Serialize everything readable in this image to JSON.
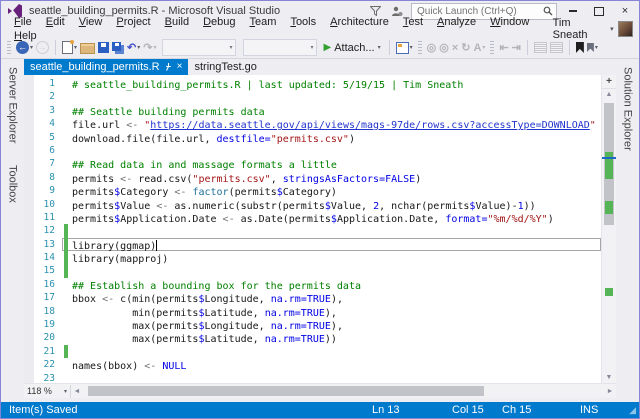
{
  "window": {
    "title": "seattle_building_permits.R - Microsoft Visual Studio",
    "quick_launch": "Quick Launch (Ctrl+Q)"
  },
  "icons": {
    "close_glyph": "×",
    "tab_close_glyph": "×",
    "split_glyph": "+",
    "up_glyph": "▲",
    "down_glyph": "▼",
    "left_glyph": "◄",
    "right_glyph": "►",
    "grip_glyph": "◢",
    "user_caret": "▾"
  },
  "menu": {
    "items": [
      "File",
      "Edit",
      "View",
      "Project",
      "Build",
      "Debug",
      "Team",
      "Tools",
      "Architecture",
      "Test",
      "Analyze",
      "Window",
      "Help"
    ],
    "user": "Tim Sneath"
  },
  "toolbar": {
    "attach_label": "Attach...",
    "items": [
      {
        "name": "toolbar-grip",
        "kind": "grip"
      },
      {
        "name": "navigate-back-button",
        "kind": "css",
        "cls": "i-back",
        "glyph": "←",
        "caret": true
      },
      {
        "name": "navigate-forward-button",
        "kind": "css",
        "cls": "i-fwd",
        "glyph": "→",
        "disabled": true
      },
      {
        "name": "toolbar-separator",
        "kind": "sep"
      },
      {
        "name": "new-file-button",
        "kind": "css",
        "cls": "i-new",
        "caret": true
      },
      {
        "name": "open-file-button",
        "kind": "css",
        "cls": "i-open"
      },
      {
        "name": "save-button",
        "kind": "css",
        "cls": "i-save"
      },
      {
        "name": "save-all-button",
        "kind": "css",
        "cls": "i-saveall"
      },
      {
        "name": "undo-button",
        "kind": "glyph",
        "glyph": "↶",
        "color": "#4650C8",
        "caret": true
      },
      {
        "name": "redo-button",
        "kind": "glyph",
        "glyph": "↷",
        "disabled": true,
        "caret": true
      },
      {
        "name": "debug-target-combobox",
        "kind": "combo"
      },
      {
        "name": "solution-configurations-combobox",
        "kind": "combo"
      },
      {
        "name": "attach-debugger-button",
        "kind": "attach",
        "caret": true
      },
      {
        "name": "toolbar-separator",
        "kind": "sep"
      },
      {
        "name": "breakpoints-window-button",
        "kind": "css",
        "cls": "i-bpwin",
        "caret": true
      },
      {
        "name": "toolbar-grip",
        "kind": "grip"
      },
      {
        "name": "break-all-button",
        "kind": "glyph",
        "glyph": "◎",
        "disabled": true
      },
      {
        "name": "stop-debugging-button",
        "kind": "glyph",
        "glyph": "◎",
        "disabled": true
      },
      {
        "name": "close-debugger-button",
        "kind": "glyph",
        "glyph": "×",
        "disabled": true
      },
      {
        "name": "restart-button",
        "kind": "glyph",
        "glyph": "↻",
        "disabled": true
      },
      {
        "name": "font-options-button",
        "kind": "glyph",
        "glyph": "A",
        "disabled": true,
        "caret": true
      },
      {
        "name": "toolbar-grip",
        "kind": "grip"
      },
      {
        "name": "indent-decrease-button",
        "kind": "glyph",
        "glyph": "⇤",
        "disabled": true
      },
      {
        "name": "indent-increase-button",
        "kind": "glyph",
        "glyph": "⇥",
        "disabled": true
      },
      {
        "name": "toolbar-separator",
        "kind": "sep"
      },
      {
        "name": "comment-button",
        "kind": "css",
        "cls": "i-comment",
        "disabled": true
      },
      {
        "name": "uncomment-button",
        "kind": "css",
        "cls": "i-comment",
        "disabled": true
      },
      {
        "name": "toolbar-separator",
        "kind": "sep"
      },
      {
        "name": "toggle-bookmark-button",
        "kind": "css",
        "cls": "i-bookmark"
      },
      {
        "name": "next-bookmark-button",
        "kind": "css",
        "cls": "i-bookmark-sm",
        "caret": true
      }
    ]
  },
  "tabs": [
    {
      "label": "seattle_building_permits.R",
      "active": true
    },
    {
      "label": "stringTest.go",
      "active": false
    }
  ],
  "side": {
    "left": [
      "Server Explorer",
      "Toolbox"
    ],
    "right": [
      "Solution Explorer"
    ]
  },
  "editor": {
    "zoom_level": "118 %",
    "lines": [
      {
        "n": 1,
        "segs": [
          [
            "com",
            "# seattle_building_permits.R | last updated: 5/19/15 | Tim Sneath"
          ]
        ]
      },
      {
        "n": 2,
        "segs": []
      },
      {
        "n": 3,
        "segs": [
          [
            "com",
            "## Seattle building permits data"
          ]
        ]
      },
      {
        "n": 4,
        "segs": [
          [
            "txt",
            "file.url "
          ],
          [
            "op",
            "<- "
          ],
          [
            "str",
            "\""
          ],
          [
            "url",
            "https://data.seattle.gov/api/views/mags-97de/rows.csv?accessType=DOWNLOAD"
          ],
          [
            "str",
            "\""
          ]
        ]
      },
      {
        "n": 5,
        "segs": [
          [
            "txt",
            "download.file(file.url, "
          ],
          [
            "kw",
            "destfile="
          ],
          [
            "str",
            "\"permits.csv\""
          ],
          [
            "txt",
            ")"
          ]
        ]
      },
      {
        "n": 6,
        "segs": []
      },
      {
        "n": 7,
        "segs": [
          [
            "com",
            "## Read data in and massage formats a little"
          ]
        ]
      },
      {
        "n": 8,
        "segs": [
          [
            "txt",
            "permits "
          ],
          [
            "op",
            "<- "
          ],
          [
            "txt",
            "read.csv("
          ],
          [
            "str",
            "\"permits.csv\""
          ],
          [
            "txt",
            ", "
          ],
          [
            "kw",
            "stringsAsFactors=FALSE"
          ],
          [
            "txt",
            ")"
          ]
        ]
      },
      {
        "n": 9,
        "segs": [
          [
            "txt",
            "permits"
          ],
          [
            "kw",
            "$"
          ],
          [
            "txt",
            "Category "
          ],
          [
            "op",
            "<- "
          ],
          [
            "fn",
            "factor"
          ],
          [
            "txt",
            "(permits"
          ],
          [
            "kw",
            "$"
          ],
          [
            "txt",
            "Category)"
          ]
        ]
      },
      {
        "n": 10,
        "segs": [
          [
            "txt",
            "permits"
          ],
          [
            "kw",
            "$"
          ],
          [
            "txt",
            "Value "
          ],
          [
            "op",
            "<- "
          ],
          [
            "txt",
            "as.numeric(substr(permits"
          ],
          [
            "kw",
            "$"
          ],
          [
            "txt",
            "Value, "
          ],
          [
            "kw",
            "2"
          ],
          [
            "txt",
            ", nchar(permits"
          ],
          [
            "kw",
            "$"
          ],
          [
            "txt",
            "Value)-"
          ],
          [
            "kw",
            "1"
          ],
          [
            "txt",
            "))"
          ]
        ]
      },
      {
        "n": 11,
        "segs": [
          [
            "txt",
            "permits"
          ],
          [
            "kw",
            "$"
          ],
          [
            "txt",
            "Application.Date "
          ],
          [
            "op",
            "<- "
          ],
          [
            "txt",
            "as.Date(permits"
          ],
          [
            "kw",
            "$"
          ],
          [
            "txt",
            "Application.Date, "
          ],
          [
            "kw",
            "format="
          ],
          [
            "str",
            "\"%m/%d/%Y\""
          ],
          [
            "txt",
            ")"
          ]
        ]
      },
      {
        "n": 12,
        "changed": true,
        "segs": []
      },
      {
        "n": 13,
        "changed": true,
        "current": true,
        "cursor": true,
        "segs": [
          [
            "txt",
            "library(ggmap)"
          ]
        ]
      },
      {
        "n": 14,
        "changed": true,
        "segs": [
          [
            "txt",
            "library(mapproj)"
          ]
        ]
      },
      {
        "n": 15,
        "changed": true,
        "segs": []
      },
      {
        "n": 16,
        "segs": [
          [
            "com",
            "## Establish a bounding box for the permits data"
          ]
        ]
      },
      {
        "n": 17,
        "segs": [
          [
            "txt",
            "bbox "
          ],
          [
            "op",
            "<- "
          ],
          [
            "txt",
            "c(min(permits"
          ],
          [
            "kw",
            "$"
          ],
          [
            "txt",
            "Longitude, "
          ],
          [
            "kw",
            "na.rm=TRUE"
          ],
          [
            "txt",
            "),"
          ]
        ]
      },
      {
        "n": 18,
        "segs": [
          [
            "txt",
            "          min(permits"
          ],
          [
            "kw",
            "$"
          ],
          [
            "txt",
            "Latitude, "
          ],
          [
            "kw",
            "na.rm=TRUE"
          ],
          [
            "txt",
            "),"
          ]
        ]
      },
      {
        "n": 19,
        "segs": [
          [
            "txt",
            "          max(permits"
          ],
          [
            "kw",
            "$"
          ],
          [
            "txt",
            "Longitude, "
          ],
          [
            "kw",
            "na.rm=TRUE"
          ],
          [
            "txt",
            "),"
          ]
        ]
      },
      {
        "n": 20,
        "segs": [
          [
            "txt",
            "          max(permits"
          ],
          [
            "kw",
            "$"
          ],
          [
            "txt",
            "Latitude, "
          ],
          [
            "kw",
            "na.rm=TRUE"
          ],
          [
            "txt",
            "))"
          ]
        ]
      },
      {
        "n": 21,
        "changed": true,
        "segs": []
      },
      {
        "n": 22,
        "segs": [
          [
            "txt",
            "names(bbox) "
          ],
          [
            "op",
            "<- "
          ],
          [
            "kw",
            "NULL"
          ]
        ]
      },
      {
        "n": 23,
        "segs": []
      }
    ],
    "scrollbar": {
      "thumb": {
        "top_pct": 1,
        "height_pct": 45
      },
      "change_marks": [
        {
          "top_pct": 19,
          "height_pct": 10
        },
        {
          "top_pct": 37,
          "height_pct": 5
        },
        {
          "top_pct": 69,
          "height_pct": 3
        }
      ],
      "caret_mark_top_pct": 21
    },
    "hscrollbar": {
      "thumb_left_pct": 1,
      "thumb_width_pct": 76
    }
  },
  "status": {
    "message": "Item(s) Saved",
    "line_label": "Ln 13",
    "column_label": "Col 15",
    "char_label": "Ch 15",
    "mode_label": "INS"
  },
  "colors": {
    "accent": "#007ACC",
    "active_tab": "#007ACC",
    "change_bar": "#55B455",
    "comment": "#008000",
    "string": "#A31515",
    "keyword": "#0000E6",
    "line_number": "#2B91AF",
    "logo_purple": "#68217A"
  }
}
